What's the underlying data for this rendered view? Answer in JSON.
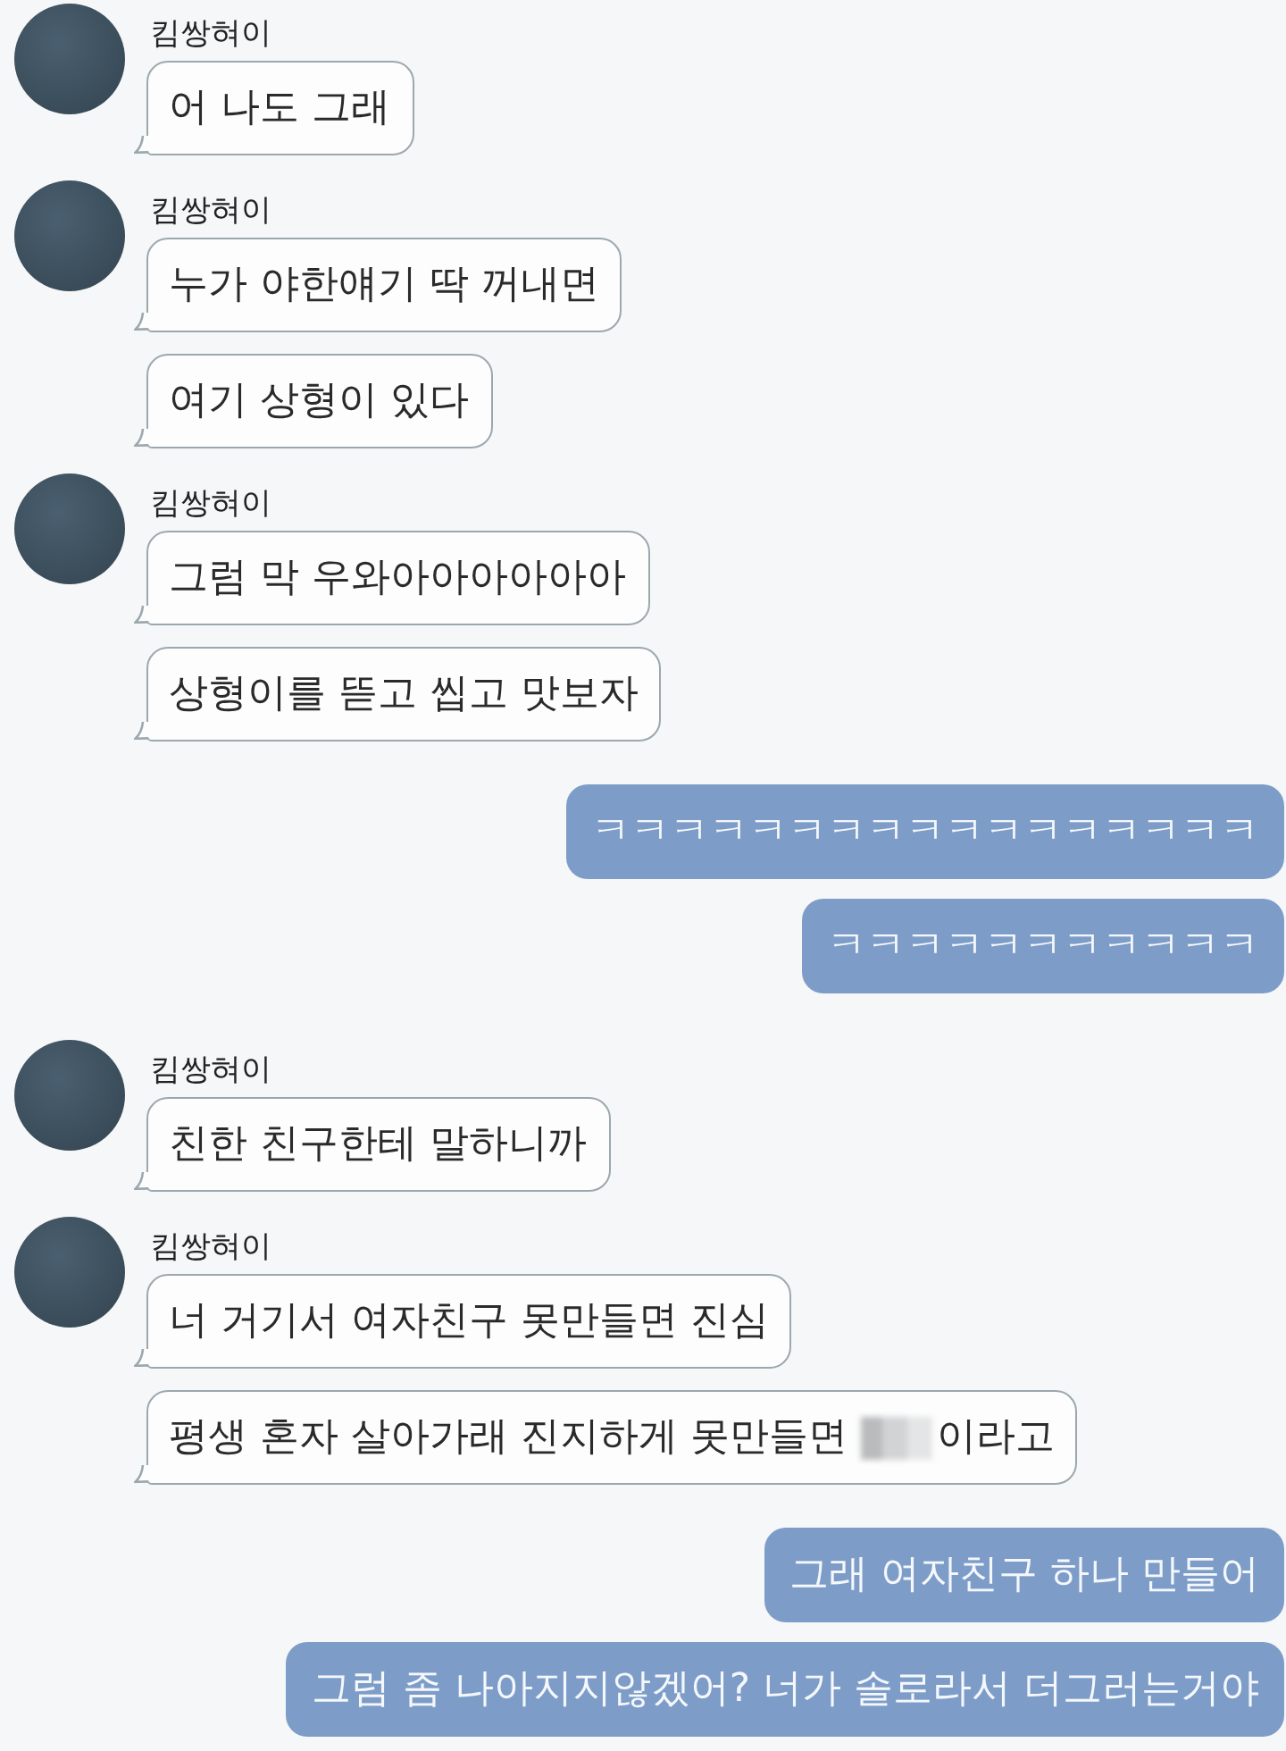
{
  "messages": [
    {
      "kind": "received",
      "sender": "킴쌍혀이",
      "bubbles": [
        {
          "text": "어 나도 그래",
          "blurred": false
        }
      ]
    },
    {
      "kind": "received",
      "sender": "킴쌍혀이",
      "bubbles": [
        {
          "text": "누가 야한얘기 딱 꺼내면",
          "blurred": false
        },
        {
          "text": "여기 상형이 있다",
          "blurred": false
        }
      ]
    },
    {
      "kind": "received",
      "sender": "킴쌍혀이",
      "bubbles": [
        {
          "text": "그럼 막 우와아아아아아아",
          "blurred": false
        },
        {
          "text": "상형이를 뜯고 씹고 맛보자",
          "blurred": false
        }
      ]
    },
    {
      "kind": "sent",
      "text": "ㅋㅋㅋㅋㅋㅋㅋㅋㅋㅋㅋㅋㅋㅋㅋㅋㅋ"
    },
    {
      "kind": "sent",
      "text": "ㅋㅋㅋㅋㅋㅋㅋㅋㅋㅋㅋ"
    },
    {
      "kind": "received",
      "sender": "킴쌍혀이",
      "bubbles": [
        {
          "text": "친한 친구한테 말하니까",
          "blurred": false
        }
      ]
    },
    {
      "kind": "received",
      "sender": "킴쌍혀이",
      "bubbles": [
        {
          "text": "너 거기서 여자친구 못만들면 진심",
          "blurred": false
        },
        {
          "text": "평생 혼자 살아가래 진지하게 못만들면",
          "blurred": true,
          "text_after": "이라고"
        }
      ]
    },
    {
      "kind": "sent",
      "text": "그래 여자친구 하나 만들어"
    },
    {
      "kind": "sent",
      "text": "그럼 좀 나아지지않겠어? 너가 솔로라서 더그러는거야"
    }
  ]
}
